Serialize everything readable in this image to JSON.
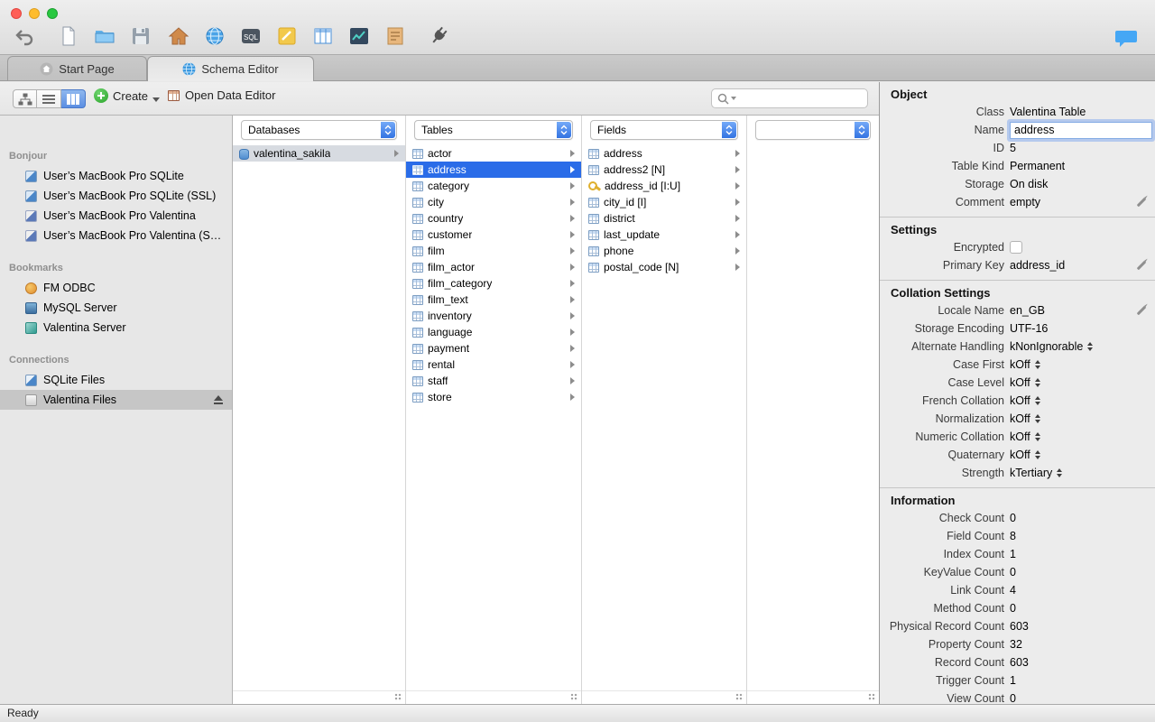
{
  "tabs": {
    "start_page": "Start Page",
    "schema_editor": "Schema Editor"
  },
  "subtoolbar": {
    "create": "Create",
    "open_data_editor": "Open Data Editor",
    "search_placeholder": ""
  },
  "sidebar": {
    "bonjour": {
      "title": "Bonjour",
      "items": [
        {
          "label": "User’s MacBook Pro SQLite",
          "icon": "sqlite"
        },
        {
          "label": "User’s MacBook Pro SQLite (SSL)",
          "icon": "sqlite"
        },
        {
          "label": "User’s MacBook Pro Valentina",
          "icon": "valentina"
        },
        {
          "label": "User’s MacBook Pro Valentina (S…",
          "icon": "valentina"
        }
      ]
    },
    "bookmarks": {
      "title": "Bookmarks",
      "items": [
        {
          "label": "FM ODBC",
          "icon": "odbc"
        },
        {
          "label": "MySQL Server",
          "icon": "mysql"
        },
        {
          "label": "Valentina Server",
          "icon": "vserver"
        }
      ]
    },
    "connections": {
      "title": "Connections",
      "items": [
        {
          "label": "SQLite Files",
          "icon": "sqlite-files"
        },
        {
          "label": "Valentina Files",
          "icon": "valentina-files",
          "sel": "selected",
          "eject": true
        }
      ]
    }
  },
  "browser": {
    "databases": {
      "header": "Databases",
      "items": [
        {
          "label": "valentina_sakila",
          "icon": "database",
          "sel": "sel-inactive"
        }
      ]
    },
    "tables": {
      "header": "Tables",
      "items": [
        {
          "label": "actor",
          "icon": "table"
        },
        {
          "label": "address",
          "icon": "table",
          "sel": "selected"
        },
        {
          "label": "category",
          "icon": "table"
        },
        {
          "label": "city",
          "icon": "table"
        },
        {
          "label": "country",
          "icon": "table"
        },
        {
          "label": "customer",
          "icon": "table"
        },
        {
          "label": "film",
          "icon": "table"
        },
        {
          "label": "film_actor",
          "icon": "table"
        },
        {
          "label": "film_category",
          "icon": "table"
        },
        {
          "label": "film_text",
          "icon": "table"
        },
        {
          "label": "inventory",
          "icon": "table"
        },
        {
          "label": "language",
          "icon": "table"
        },
        {
          "label": "payment",
          "icon": "table"
        },
        {
          "label": "rental",
          "icon": "table"
        },
        {
          "label": "staff",
          "icon": "table"
        },
        {
          "label": "store",
          "icon": "table"
        }
      ]
    },
    "fields": {
      "header": "Fields",
      "items": [
        {
          "label": "address",
          "icon": "table"
        },
        {
          "label": "address2 [N]",
          "icon": "table"
        },
        {
          "label": "address_id [I:U]",
          "icon": "key"
        },
        {
          "label": "city_id [I]",
          "icon": "table"
        },
        {
          "label": "district",
          "icon": "table"
        },
        {
          "label": "last_update",
          "icon": "table"
        },
        {
          "label": "phone",
          "icon": "table"
        },
        {
          "label": "postal_code [N]",
          "icon": "table"
        }
      ]
    },
    "links": {
      "header": ""
    }
  },
  "inspector": {
    "object": {
      "title": "Object",
      "class_label": "Class",
      "class_value": "Valentina Table",
      "name_label": "Name",
      "name_value": "address",
      "id_label": "ID",
      "id_value": "5",
      "table_kind_label": "Table Kind",
      "table_kind_value": "Permanent",
      "storage_label": "Storage",
      "storage_value": "On disk",
      "comment_label": "Comment",
      "comment_value": "empty"
    },
    "settings": {
      "title": "Settings",
      "encrypted_label": "Encrypted",
      "primary_key_label": "Primary Key",
      "primary_key_value": "address_id"
    },
    "collation": {
      "title": "Collation Settings",
      "locale_label": "Locale Name",
      "locale_value": "en_GB",
      "encoding_label": "Storage Encoding",
      "encoding_value": "UTF-16",
      "selects": [
        {
          "label": "Alternate Handling",
          "value": "kNonIgnorable"
        },
        {
          "label": "Case First",
          "value": "kOff"
        },
        {
          "label": "Case Level",
          "value": "kOff"
        },
        {
          "label": "French Collation",
          "value": "kOff"
        },
        {
          "label": "Normalization",
          "value": "kOff"
        },
        {
          "label": "Numeric Collation",
          "value": "kOff"
        },
        {
          "label": "Quaternary",
          "value": "kOff"
        },
        {
          "label": "Strength",
          "value": "kTertiary"
        }
      ]
    },
    "information": {
      "title": "Information",
      "rows": [
        {
          "label": "Check Count",
          "value": "0"
        },
        {
          "label": "Field Count",
          "value": "8"
        },
        {
          "label": "Index Count",
          "value": "1"
        },
        {
          "label": "KeyValue Count",
          "value": "0"
        },
        {
          "label": "Link Count",
          "value": "4"
        },
        {
          "label": "Method Count",
          "value": "0"
        },
        {
          "label": "Physical Record Count",
          "value": "603"
        },
        {
          "label": "Property Count",
          "value": "32"
        },
        {
          "label": "Record Count",
          "value": "603"
        },
        {
          "label": "Trigger Count",
          "value": "1"
        },
        {
          "label": "View Count",
          "value": "0"
        }
      ]
    }
  },
  "statusbar": {
    "text": "Ready"
  }
}
